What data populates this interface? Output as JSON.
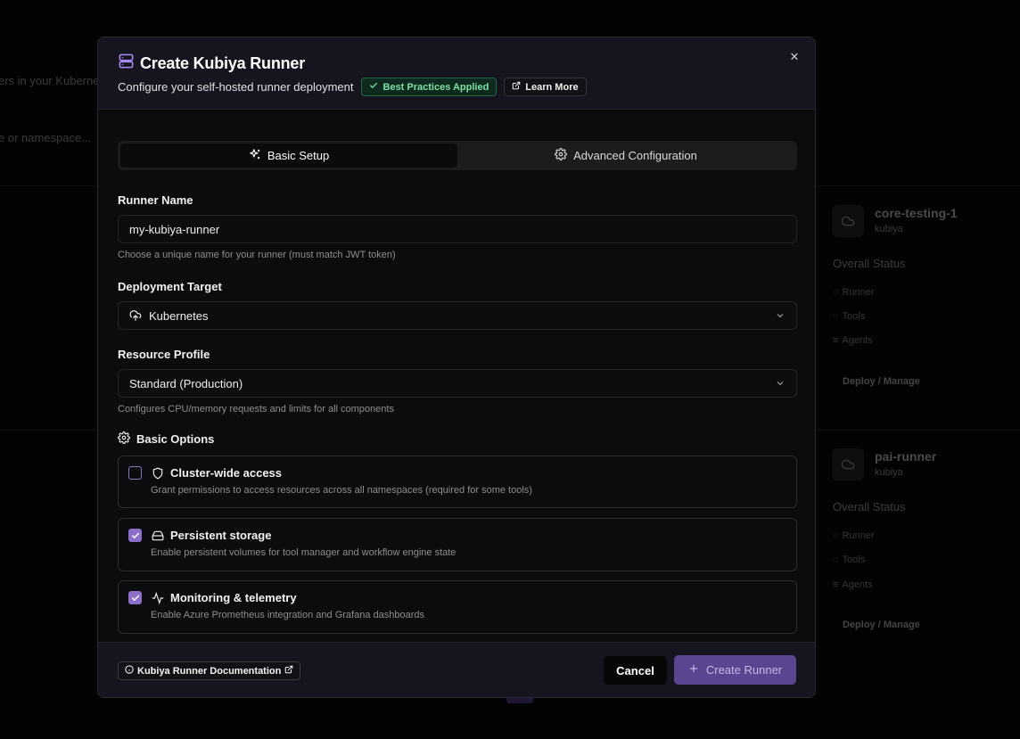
{
  "background": {
    "text_1": "ers in your Kubernet",
    "text_2": "e or namespace...",
    "cards": [
      {
        "name": "core-testing-1",
        "org": "kubiya",
        "overall": "Overall Status",
        "rows": [
          "Runner",
          "Tools",
          "Agents"
        ],
        "action": "Deploy / Manage"
      },
      {
        "name": "pai-runner",
        "org": "kubiya",
        "overall": "Overall Status",
        "rows": [
          "Runner",
          "Tools",
          "Agents"
        ],
        "action": "Deploy / Manage"
      }
    ]
  },
  "modal": {
    "title": "Create Kubiya Runner",
    "subtitle": "Configure your self-hosted runner deployment",
    "badge_best_practices": "Best Practices Applied",
    "learn_more": "Learn More",
    "close_glyph": "✕",
    "tabs": [
      {
        "label": "Basic Setup",
        "active": true
      },
      {
        "label": "Advanced Configuration",
        "active": false
      }
    ],
    "runner_name": {
      "label": "Runner Name",
      "value": "my-kubiya-runner",
      "help": "Choose a unique name for your runner (must match JWT token)"
    },
    "deployment_target": {
      "label": "Deployment Target",
      "value": "Kubernetes"
    },
    "resource_profile": {
      "label": "Resource Profile",
      "value": "Standard (Production)",
      "help": "Configures CPU/memory requests and limits for all components"
    },
    "basic_options": {
      "title": "Basic Options",
      "options": [
        {
          "title": "Cluster-wide access",
          "description": "Grant permissions to access resources across all namespaces (required for some tools)",
          "checked": false,
          "icon": "shield-icon"
        },
        {
          "title": "Persistent storage",
          "description": "Enable persistent volumes for tool manager and workflow engine state",
          "checked": true,
          "icon": "hard-drive-icon"
        },
        {
          "title": "Monitoring & telemetry",
          "description": "Enable Azure Prometheus integration and Grafana dashboards",
          "checked": true,
          "icon": "activity-icon"
        }
      ]
    },
    "footer": {
      "docs_link": "Kubiya Runner Documentation",
      "cancel": "Cancel",
      "create": "Create Runner"
    }
  },
  "colors": {
    "accent": "#8d6ec9",
    "create_button": "#5a4690",
    "success": "#7ce0a7"
  }
}
